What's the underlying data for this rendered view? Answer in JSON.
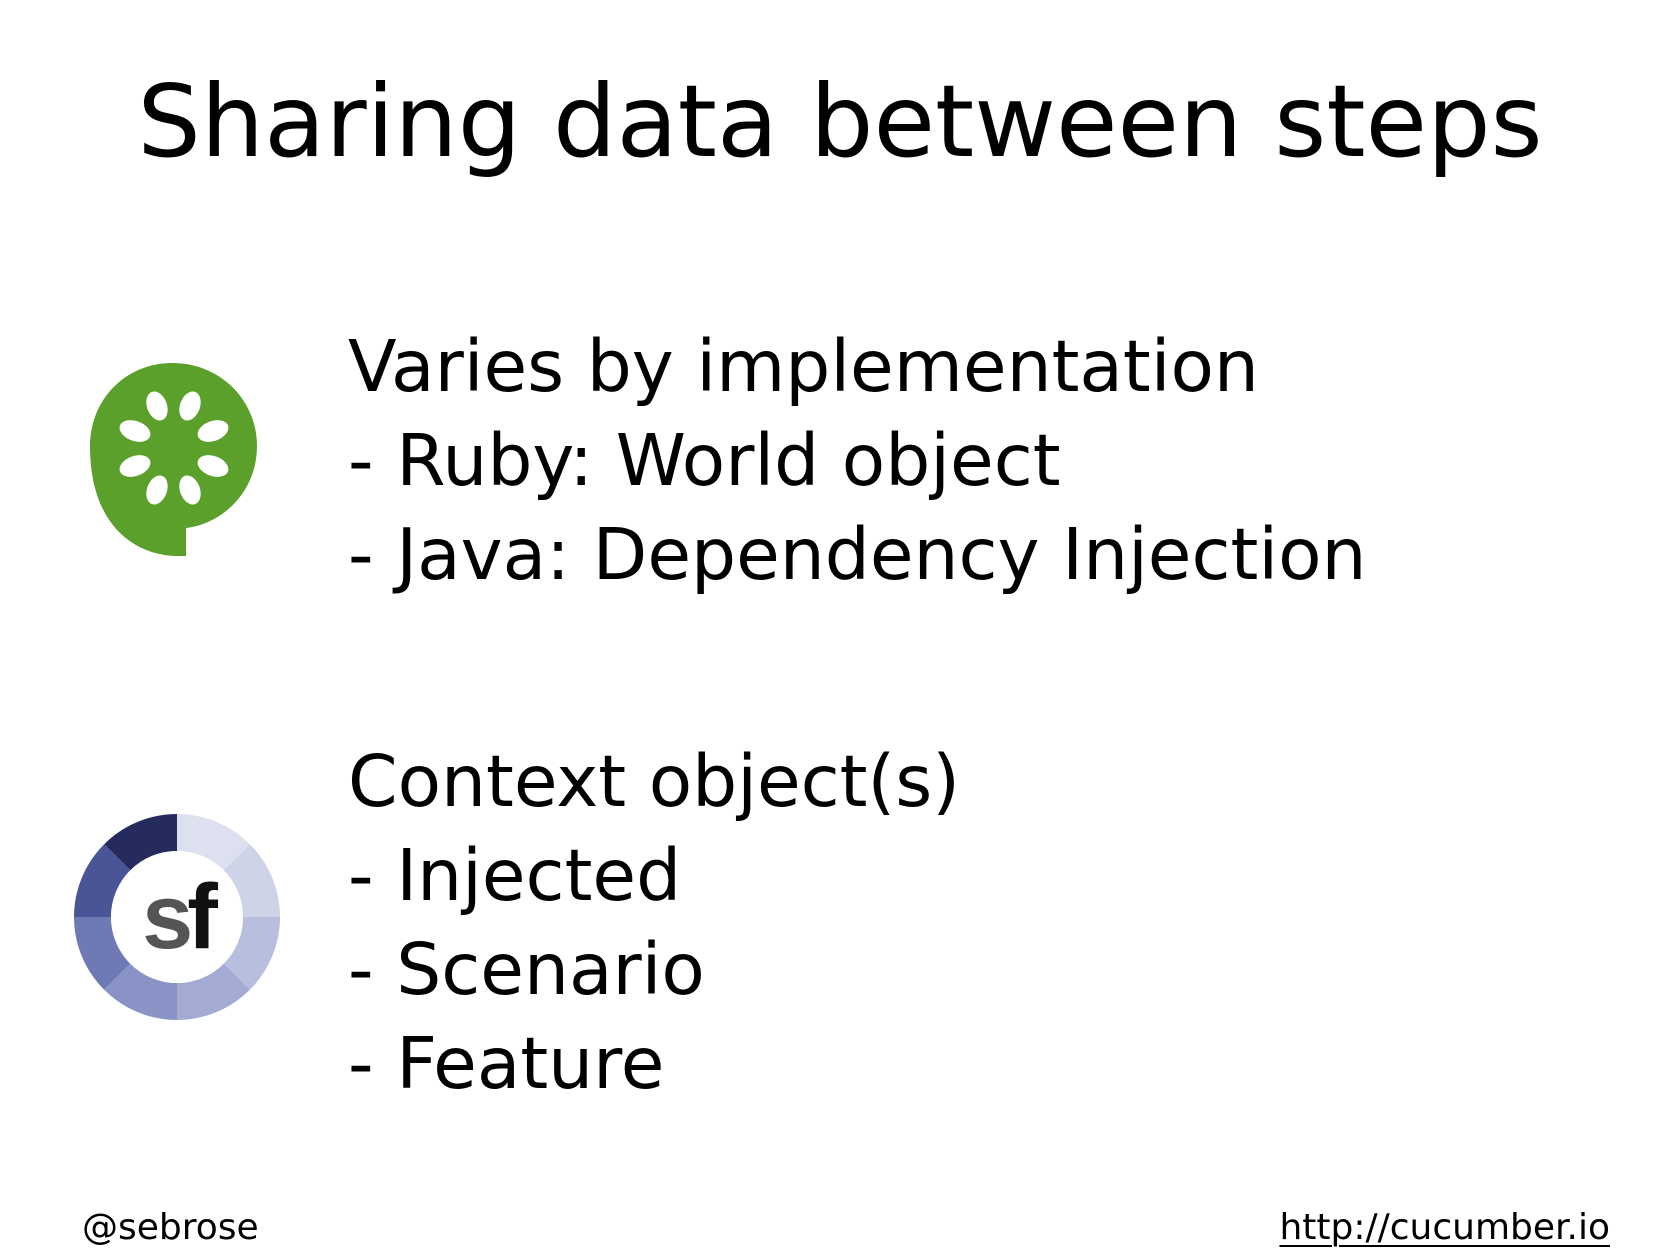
{
  "slide": {
    "title": "Sharing data between steps",
    "cucumber_block": {
      "heading": "Varies by implementation",
      "items": [
        "- Ruby: World object",
        "- Java: Dependency Injection"
      ]
    },
    "specflow_block": {
      "heading": "Context object(s)",
      "items": [
        "- Injected",
        "- Scenario",
        "- Feature"
      ]
    }
  },
  "footer": {
    "handle": "@sebrose",
    "url": "http://cucumber.io"
  },
  "logos": {
    "cucumber": {
      "icon": "cucumber-logo-icon",
      "color": "#5ba02a"
    },
    "specflow": {
      "icon": "specflow-logo-icon",
      "text": "sf"
    }
  }
}
